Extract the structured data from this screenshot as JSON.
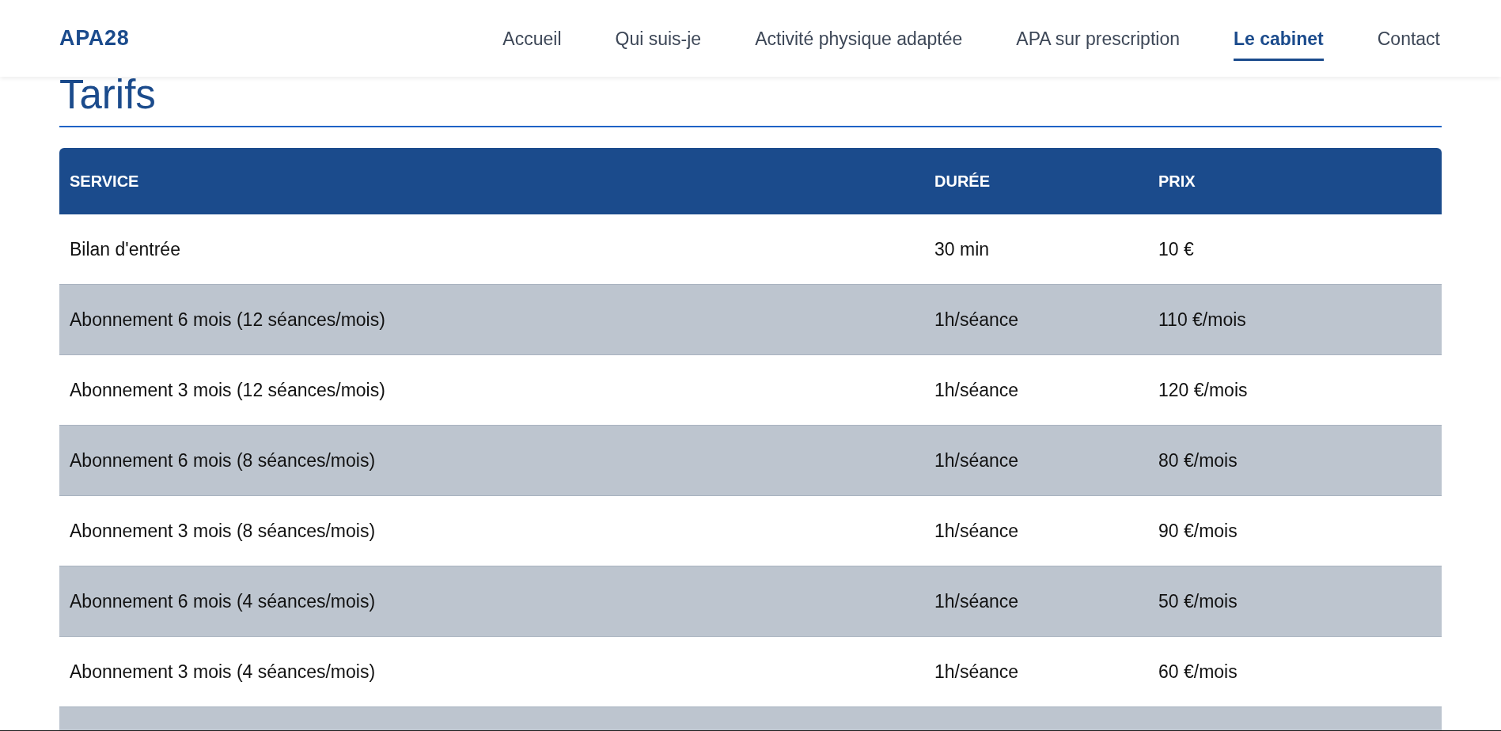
{
  "header": {
    "logo": "APA28",
    "nav": [
      {
        "label": "Accueil",
        "selected": false
      },
      {
        "label": "Qui suis-je",
        "selected": false
      },
      {
        "label": "Activité physique adaptée",
        "selected": false
      },
      {
        "label": "APA sur prescription",
        "selected": false
      },
      {
        "label": "Le cabinet",
        "selected": true
      },
      {
        "label": "Contact",
        "selected": false
      }
    ]
  },
  "section": {
    "title": "Tarifs"
  },
  "table": {
    "columns": [
      "SERVICE",
      "DURÉE",
      "PRIX"
    ],
    "rows": [
      [
        "Bilan d'entrée",
        "30 min",
        "10 €"
      ],
      [
        "Abonnement 6 mois (12 séances/mois)",
        "1h/séance",
        "110 €/mois"
      ],
      [
        "Abonnement 3 mois (12 séances/mois)",
        "1h/séance",
        "120 €/mois"
      ],
      [
        "Abonnement 6 mois (8 séances/mois)",
        "1h/séance",
        "80 €/mois"
      ],
      [
        "Abonnement 3 mois (8 séances/mois)",
        "1h/séance",
        "90 €/mois"
      ],
      [
        "Abonnement 6 mois (4 séances/mois)",
        "1h/séance",
        "50 €/mois"
      ],
      [
        "Abonnement 3 mois (4 séances/mois)",
        "1h/séance",
        "60 €/mois"
      ]
    ]
  }
}
